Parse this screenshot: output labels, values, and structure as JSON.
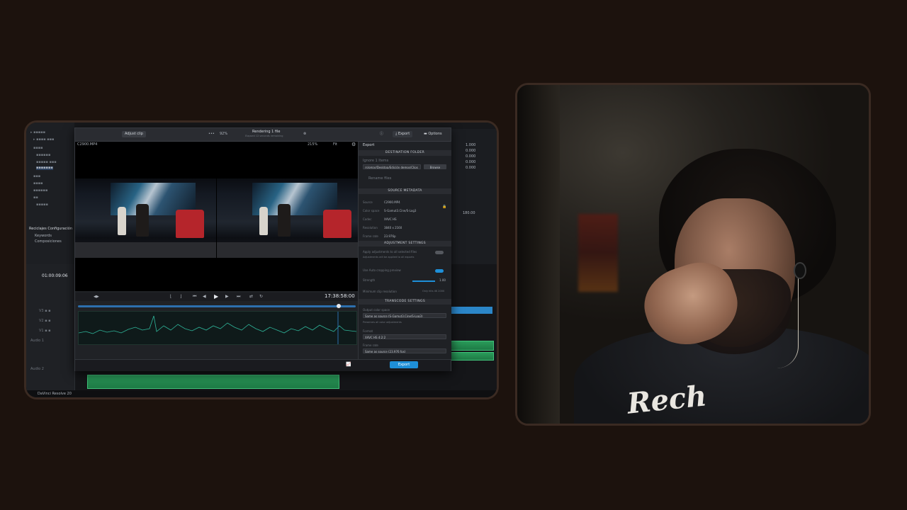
{
  "editor": {
    "timecode_left": "01:00:09:06",
    "project_label": "DaVinci Resolve 20",
    "left_items": [
      "Reciclajes Configuración",
      "Keywords",
      "Composiciones"
    ],
    "insp_values": [
      "1.000",
      "0.000",
      "0.000",
      "0.000",
      "0.000",
      "180.00"
    ]
  },
  "modal": {
    "top": {
      "chip_left": "Adjust clip",
      "percent": "92%",
      "status_title": "Rendering 1 file",
      "status_sub": "Elapsed 12 seconds remaining",
      "export_label": "Export",
      "options_label": "Options"
    },
    "clip_name": "C2900.MP4",
    "zoom": "215%",
    "fit": "Fit",
    "timecode": "17:38:58:00",
    "side": {
      "export_tab": "Export",
      "dest_header": "DESTINATION FOLDER",
      "ignore_label": "Ignore 1 Items",
      "dest_path": "rs/omar/Desktop/Edición demos/Clips",
      "browse": "Browse",
      "rename_files": "Rename files",
      "source_header": "SOURCE METADATA",
      "meta_rows": [
        {
          "k": "Source",
          "v": "C2900.MP4"
        },
        {
          "k": "Color space",
          "v": "S-Gamut3.Cine/S-Log3"
        },
        {
          "k": "Codec",
          "v": "XAVC HS"
        },
        {
          "k": "Resolution",
          "v": "3840 x 2160"
        },
        {
          "k": "Frame rate",
          "v": "23.976p"
        }
      ],
      "adjust_header": "ADJUSTMENT SETTINGS",
      "apply_label": "Apply adjustments to all selected files",
      "apply_note": "Adjustments will be applied to all exports",
      "loop_label": "Use Auto cropping preview",
      "strength_label": "Strength",
      "strength_val": "1.00",
      "min_clip_label": "Minimum clip resolution",
      "min_clip_val": "Only hits 4K 2000",
      "transcode_header": "TRANSCODE SETTINGS",
      "output_label": "Output color space",
      "output_value": "Same as source (S-Gamut3.Cine/S-Log3)",
      "output_note": "Preserves all color adjustments",
      "format_label": "Format",
      "format_value": "XAVC HS 4:2:2",
      "frame_rate_label": "Frame rate",
      "frame_rate_value": "Same as source (23.976 fps)",
      "export_button": "Export"
    },
    "progress": 0.94
  },
  "colors": {
    "accent_blue": "#1e8fd8",
    "clip_green": "#2a9b5a",
    "frame_border": "#3a2a22",
    "background": "#1c120d"
  },
  "webcam": {
    "shirt_print": "Rech"
  }
}
